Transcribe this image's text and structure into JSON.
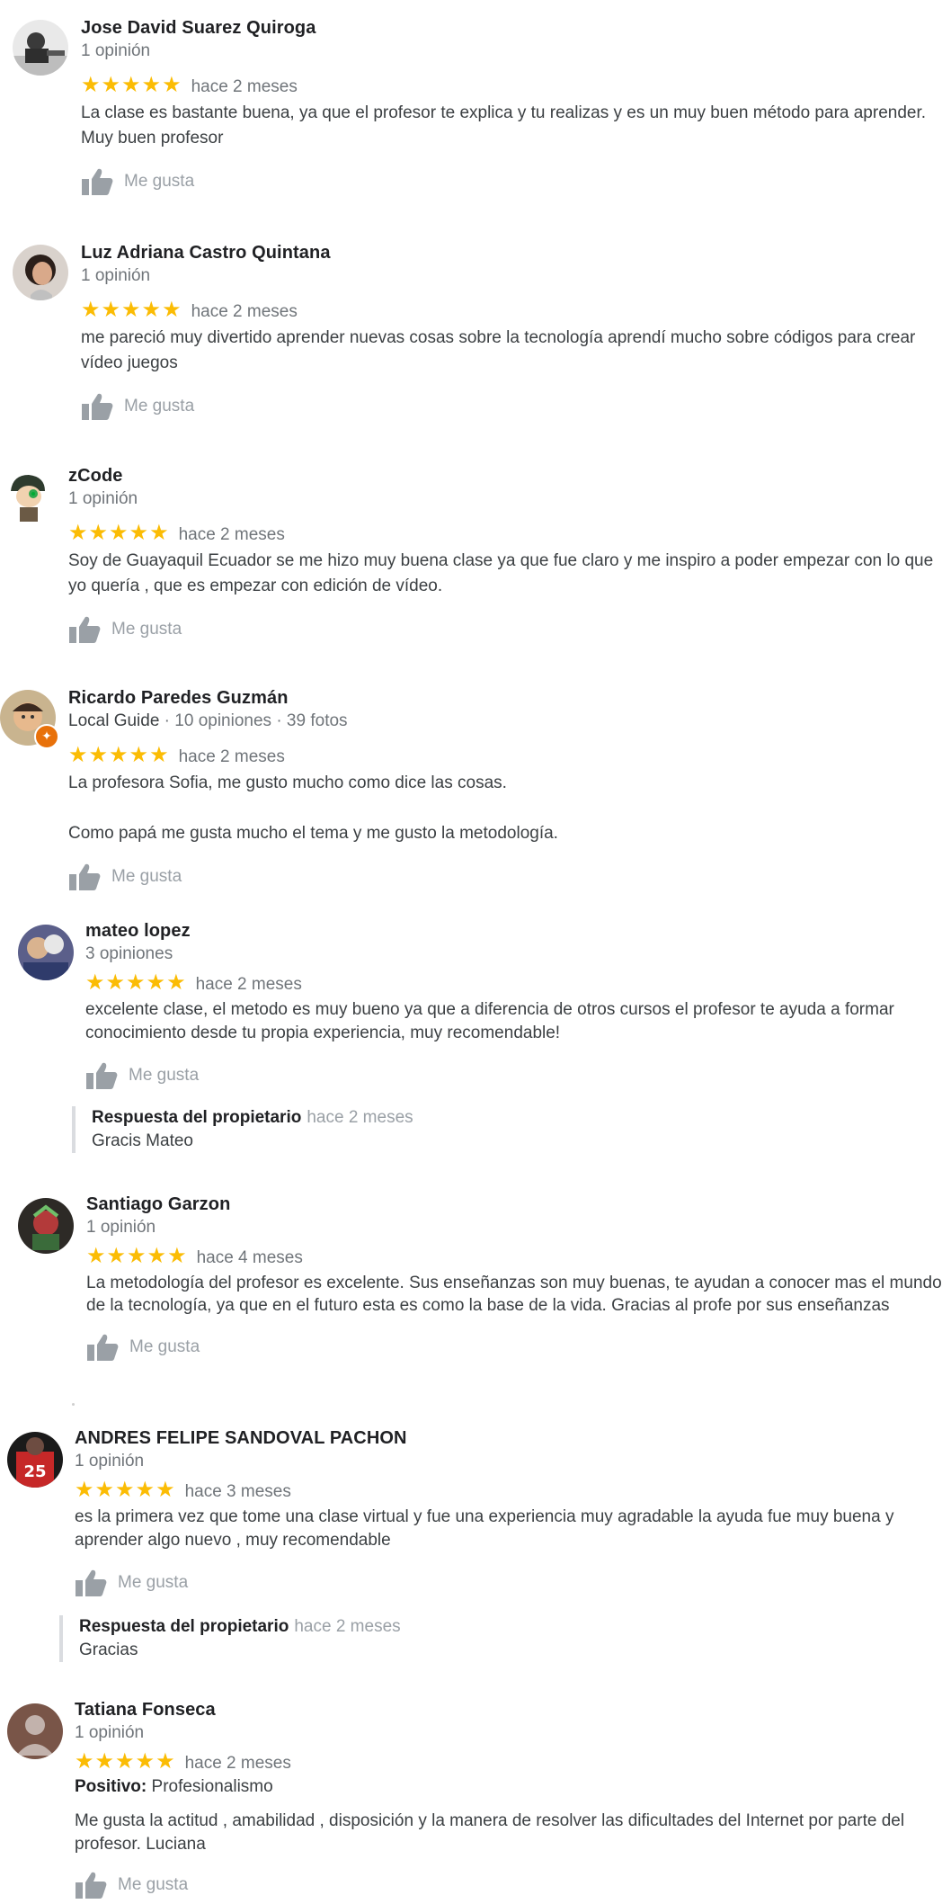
{
  "like_label": "Me gusta",
  "colors": {
    "star": "#fbbc04",
    "text": "#3c4043",
    "muted": "#70757a",
    "like": "#9aa0a6"
  },
  "reviews": [
    {
      "name": "Jose David Suarez Quiroga",
      "meta": "1 opinión",
      "stars": "★★★★★",
      "date": "hace 2 meses",
      "text": "La clase es bastante buena, ya que el profesor te explica y tu realizas y es  un muy buen método para aprender. Muy buen profesor",
      "avatar_icon": "user-photo-avatar"
    },
    {
      "name": "Luz Adriana Castro Quintana",
      "meta": "1 opinión",
      "stars": "★★★★★",
      "date": "hace 2 meses",
      "text": "me pareció muy divertido aprender nuevas cosas sobre la tecnología aprendí mucho sobre códigos para crear vídeo juegos",
      "avatar_icon": "user-photo-avatar"
    },
    {
      "name": "zCode",
      "meta": "1 opinión",
      "stars": "★★★★★",
      "date": "hace 2 meses",
      "text": "Soy de Guayaquil Ecuador se me hizo muy buena clase  ya que fue claro y me inspiro a poder empezar con lo que yo quería , que es empezar con edición de vídeo.",
      "avatar_icon": "cartoon-avatar"
    },
    {
      "name": "Ricardo Paredes Guzmán",
      "meta": "Local Guide · 10 opiniones · 39 fotos",
      "meta_strong": "Local Guide",
      "meta_rest": " · 10 opiniones · 39 fotos",
      "stars": "★★★★★",
      "date": "hace 2 meses",
      "text": "La profesora Sofia, me gusto mucho como dice las cosas.\n\nComo papá me gusta mucho el tema y me gusto la metodología.",
      "avatar_icon": "local-guide-badge-icon"
    },
    {
      "name": "mateo lopez",
      "meta": "3 opiniones",
      "stars": "★★★★★",
      "date": "hace 2 meses",
      "text": "excelente clase, el metodo es muy bueno ya que a diferencia de otros cursos el profesor te ayuda a formar conocimiento desde tu propia experiencia, muy recomendable!",
      "reply": {
        "title": "Respuesta del propietario",
        "date": "hace 2 meses",
        "text": "Gracis Mateo"
      }
    },
    {
      "name": "Santiago Garzon",
      "meta": "1 opinión",
      "stars": "★★★★★",
      "date": "hace 4 meses",
      "text": "La metodología del profesor es excelente. Sus enseñanzas son muy buenas, te ayudan a conocer mas el mundo de la tecnología, ya que en el futuro esta es como la base de la vida. Gracias al profe por sus enseñanzas"
    },
    {
      "name": "ANDRES FELIPE SANDOVAL PACHON",
      "meta": "1 opinión",
      "stars": "★★★★★",
      "date": "hace 3 meses",
      "text": "es la primera vez que tome una clase virtual  y fue una experiencia muy agradable la ayuda fue muy buena y aprender algo nuevo , muy recomendable",
      "avatar_text": "25",
      "reply": {
        "title": "Respuesta del propietario",
        "date": "hace 2 meses",
        "text": "Gracias"
      }
    },
    {
      "name": "Tatiana Fonseca",
      "meta": "1 opinión",
      "stars": "★★★★★",
      "date": "hace 2 meses",
      "positive_label": "Positivo:",
      "positive_value": "Profesionalismo",
      "text": "Me gusta la actitud , amabilidad , disposición y la manera de  resolver las dificultades del Internet por parte del profesor. Luciana"
    }
  ]
}
